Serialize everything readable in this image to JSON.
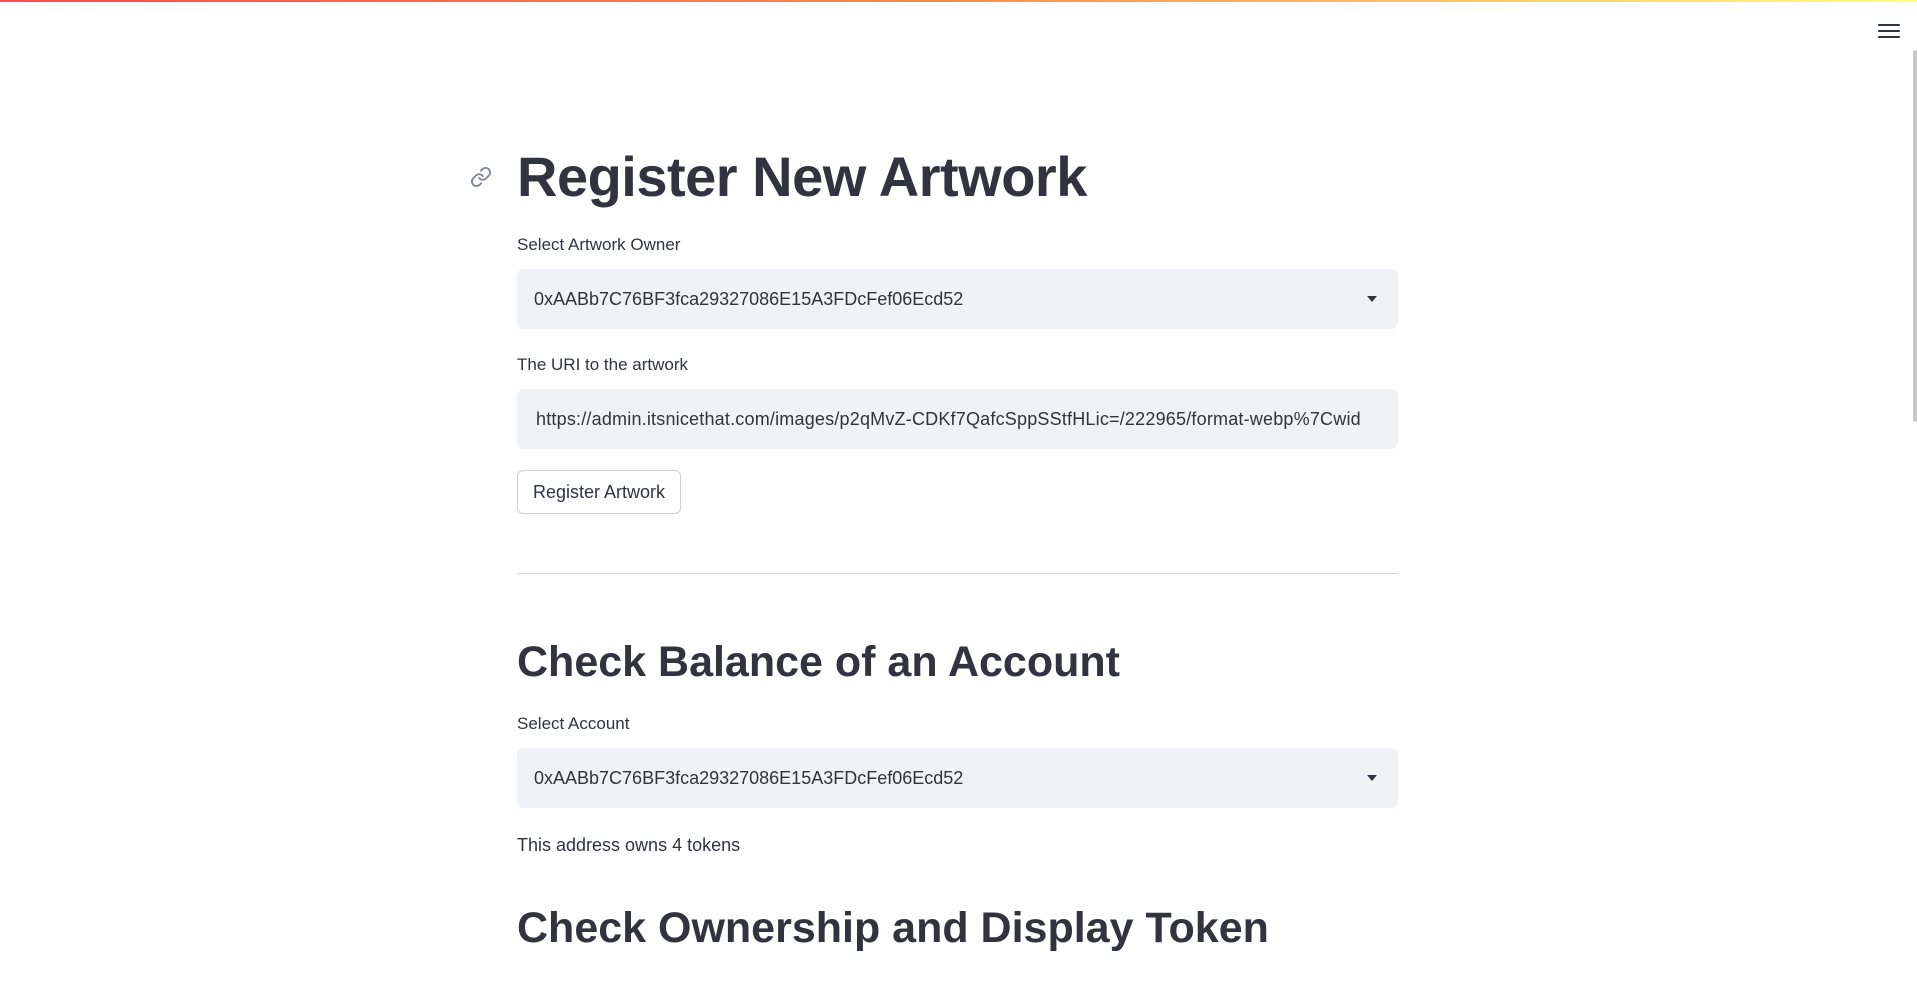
{
  "app": {
    "menu_icon": "hamburger-menu-icon",
    "accent_gradient": [
      "#ff4b4b",
      "#fffd80"
    ]
  },
  "register": {
    "title": "Register New Artwork",
    "anchor_icon": "link-icon",
    "owner_label": "Select Artwork Owner",
    "owner_value": "0xAABb7C76BF3fca29327086E15A3FDcFef06Ecd52",
    "uri_label": "The URI to the artwork",
    "uri_value": "https://admin.itsnicethat.com/images/p2qMvZ-CDKf7QafcSppSStfHLic=/222965/format-webp%7Cwid",
    "button_label": "Register Artwork"
  },
  "balance": {
    "title": "Check Balance of an Account",
    "account_label": "Select Account",
    "account_value": "0xAABb7C76BF3fca29327086E15A3FDcFef06Ecd52",
    "result_text": "This address owns 4 tokens"
  },
  "ownership": {
    "title": "Check Ownership and Display Token"
  },
  "colors": {
    "text": "#31333f",
    "input_background": "#f0f2f6",
    "background": "#ffffff"
  }
}
